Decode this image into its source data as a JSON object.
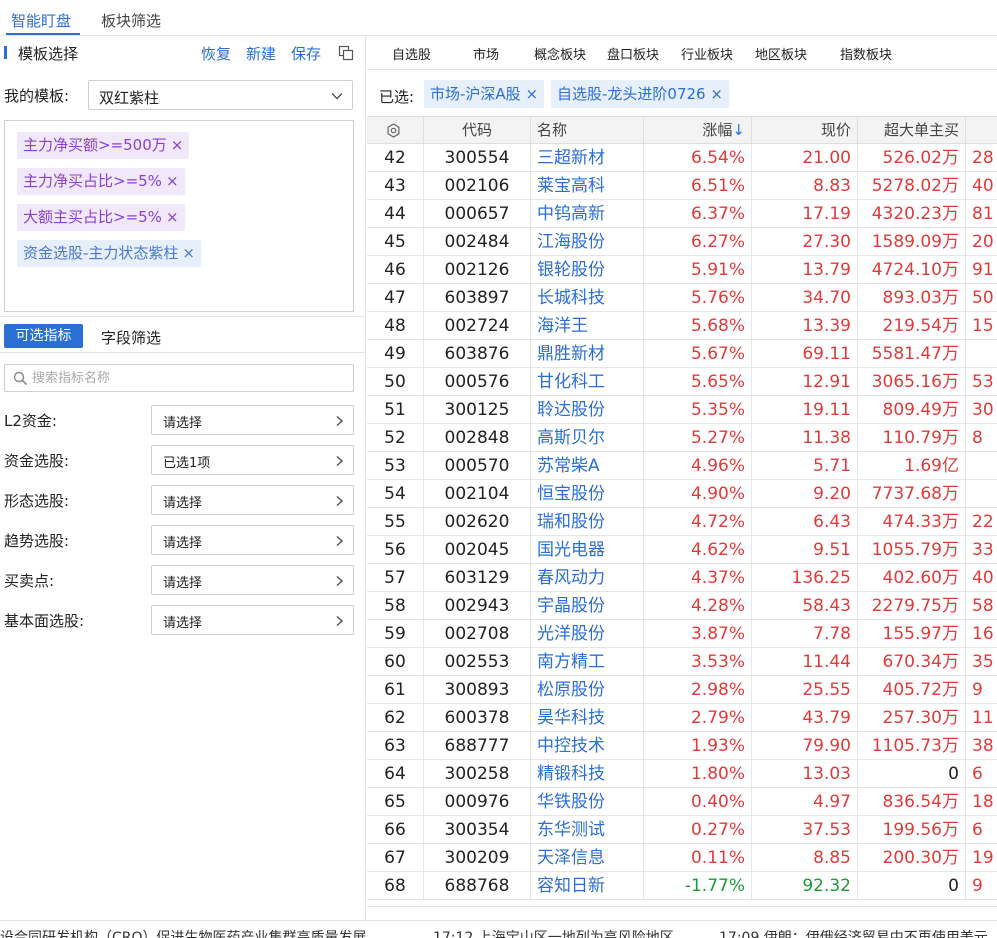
{
  "top_tabs": {
    "smart_watch": "智能盯盘",
    "sector_filter": "板块筛选"
  },
  "template": {
    "title": "模板选择",
    "restore": "恢复",
    "new": "新建",
    "save": "保存",
    "my_template_label": "我的模板:",
    "selected": "双红紫柱",
    "conditions": [
      {
        "text": "主力净买额>=500万",
        "close": "×",
        "color": "purple"
      },
      {
        "text": "主力净买占比>=5%",
        "close": "×",
        "color": "purple"
      },
      {
        "text": "大额主买占比>=5%",
        "close": "×",
        "color": "purple"
      },
      {
        "text": "资金选股-主力状态紫柱",
        "close": "×",
        "color": "blue"
      }
    ]
  },
  "indicator_tabs": {
    "available": "可选指标",
    "field_filter": "字段筛选"
  },
  "search": {
    "placeholder": "搜索指标名称"
  },
  "filters": [
    {
      "label": "L2资金:",
      "value": "请选择"
    },
    {
      "label": "资金选股:",
      "value": "已选1项"
    },
    {
      "label": "形态选股:",
      "value": "请选择"
    },
    {
      "label": "趋势选股:",
      "value": "请选择"
    },
    {
      "label": "买卖点:",
      "value": "请选择"
    },
    {
      "label": "基本面选股:",
      "value": "请选择"
    }
  ],
  "category_tabs": [
    "自选股",
    "市场",
    "概念板块",
    "盘口板块",
    "行业板块",
    "地区板块",
    "指数板块"
  ],
  "selected_label": "已选:",
  "selected_chips": [
    {
      "text": "市场-沪深A股",
      "close": "×"
    },
    {
      "text": "自选股-龙头进阶0726",
      "close": "×"
    }
  ],
  "table": {
    "columns": {
      "code": "代码",
      "name": "名称",
      "change": "涨幅",
      "sort": "↓",
      "price": "现价",
      "big_buy": "超大单主买"
    },
    "rows": [
      {
        "no": "42",
        "code": "300554",
        "name": "三超新材",
        "change": "6.54%",
        "price": "21.00",
        "big_buy": "526.02万",
        "more": "28",
        "dir": "up"
      },
      {
        "no": "43",
        "code": "002106",
        "name": "莱宝高科",
        "change": "6.51%",
        "price": "8.83",
        "big_buy": "5278.02万",
        "more": "40",
        "dir": "up"
      },
      {
        "no": "44",
        "code": "000657",
        "name": "中钨高新",
        "change": "6.37%",
        "price": "17.19",
        "big_buy": "4320.23万",
        "more": "81",
        "dir": "up"
      },
      {
        "no": "45",
        "code": "002484",
        "name": "江海股份",
        "change": "6.27%",
        "price": "27.30",
        "big_buy": "1589.09万",
        "more": "20",
        "dir": "up"
      },
      {
        "no": "46",
        "code": "002126",
        "name": "银轮股份",
        "change": "5.91%",
        "price": "13.79",
        "big_buy": "4724.10万",
        "more": "91",
        "dir": "up"
      },
      {
        "no": "47",
        "code": "603897",
        "name": "长城科技",
        "change": "5.76%",
        "price": "34.70",
        "big_buy": "893.03万",
        "more": "50",
        "dir": "up"
      },
      {
        "no": "48",
        "code": "002724",
        "name": "海洋王",
        "change": "5.68%",
        "price": "13.39",
        "big_buy": "219.54万",
        "more": "15",
        "dir": "up"
      },
      {
        "no": "49",
        "code": "603876",
        "name": "鼎胜新材",
        "change": "5.67%",
        "price": "69.11",
        "big_buy": "5581.47万",
        "more": "",
        "dir": "up"
      },
      {
        "no": "50",
        "code": "000576",
        "name": "甘化科工",
        "change": "5.65%",
        "price": "12.91",
        "big_buy": "3065.16万",
        "more": "53",
        "dir": "up"
      },
      {
        "no": "51",
        "code": "300125",
        "name": "聆达股份",
        "change": "5.35%",
        "price": "19.11",
        "big_buy": "809.49万",
        "more": "30",
        "dir": "up"
      },
      {
        "no": "52",
        "code": "002848",
        "name": "高斯贝尔",
        "change": "5.27%",
        "price": "11.38",
        "big_buy": "110.79万",
        "more": "8",
        "dir": "up"
      },
      {
        "no": "53",
        "code": "000570",
        "name": "苏常柴A",
        "change": "4.96%",
        "price": "5.71",
        "big_buy": "1.69亿",
        "more": "",
        "dir": "up"
      },
      {
        "no": "54",
        "code": "002104",
        "name": "恒宝股份",
        "change": "4.90%",
        "price": "9.20",
        "big_buy": "7737.68万",
        "more": "",
        "dir": "up"
      },
      {
        "no": "55",
        "code": "002620",
        "name": "瑞和股份",
        "change": "4.72%",
        "price": "6.43",
        "big_buy": "474.33万",
        "more": "22",
        "dir": "up"
      },
      {
        "no": "56",
        "code": "002045",
        "name": "国光电器",
        "change": "4.62%",
        "price": "9.51",
        "big_buy": "1055.79万",
        "more": "33",
        "dir": "up"
      },
      {
        "no": "57",
        "code": "603129",
        "name": "春风动力",
        "change": "4.37%",
        "price": "136.25",
        "big_buy": "402.60万",
        "more": "40",
        "dir": "up"
      },
      {
        "no": "58",
        "code": "002943",
        "name": "宇晶股份",
        "change": "4.28%",
        "price": "58.43",
        "big_buy": "2279.75万",
        "more": "58",
        "dir": "up"
      },
      {
        "no": "59",
        "code": "002708",
        "name": "光洋股份",
        "change": "3.87%",
        "price": "7.78",
        "big_buy": "155.97万",
        "more": "16",
        "dir": "up"
      },
      {
        "no": "60",
        "code": "002553",
        "name": "南方精工",
        "change": "3.53%",
        "price": "11.44",
        "big_buy": "670.34万",
        "more": "35",
        "dir": "up"
      },
      {
        "no": "61",
        "code": "300893",
        "name": "松原股份",
        "change": "2.98%",
        "price": "25.55",
        "big_buy": "405.72万",
        "more": "9",
        "dir": "up"
      },
      {
        "no": "62",
        "code": "600378",
        "name": "昊华科技",
        "change": "2.79%",
        "price": "43.79",
        "big_buy": "257.30万",
        "more": "11",
        "dir": "up"
      },
      {
        "no": "63",
        "code": "688777",
        "name": "中控技术",
        "change": "1.93%",
        "price": "79.90",
        "big_buy": "1105.73万",
        "more": "38",
        "dir": "up"
      },
      {
        "no": "64",
        "code": "300258",
        "name": "精锻科技",
        "change": "1.80%",
        "price": "13.03",
        "big_buy": "0",
        "more": "6",
        "dir": "up"
      },
      {
        "no": "65",
        "code": "000976",
        "name": "华铁股份",
        "change": "0.40%",
        "price": "4.97",
        "big_buy": "836.54万",
        "more": "18",
        "dir": "up"
      },
      {
        "no": "66",
        "code": "300354",
        "name": "东华测试",
        "change": "0.27%",
        "price": "37.53",
        "big_buy": "199.56万",
        "more": "6",
        "dir": "up"
      },
      {
        "no": "67",
        "code": "300209",
        "name": "天泽信息",
        "change": "0.11%",
        "price": "8.85",
        "big_buy": "200.30万",
        "more": "19",
        "dir": "up"
      },
      {
        "no": "68",
        "code": "688768",
        "name": "容知日新",
        "change": "-1.77%",
        "price": "92.32",
        "big_buy": "0",
        "more": "9",
        "dir": "down"
      }
    ]
  },
  "ticker": [
    "设合同研发机构（CRO）促进生物医药产业集群高质量发展",
    "17:12 上海宝山区一地列为高风险地区",
    "17:09 伊朗：伊俄经济贸易中不再使用美元"
  ],
  "colors": {
    "accent": "#2a6fd6",
    "up": "#e23a3a",
    "down": "#1a9a3a",
    "tag_purple": "#8a3fd1"
  },
  "icons": {
    "copy": "copy-icon",
    "chevron": "chevron-down-icon",
    "search": "search-icon",
    "gear": "gear-icon",
    "arrow": "chevron-right-icon"
  }
}
